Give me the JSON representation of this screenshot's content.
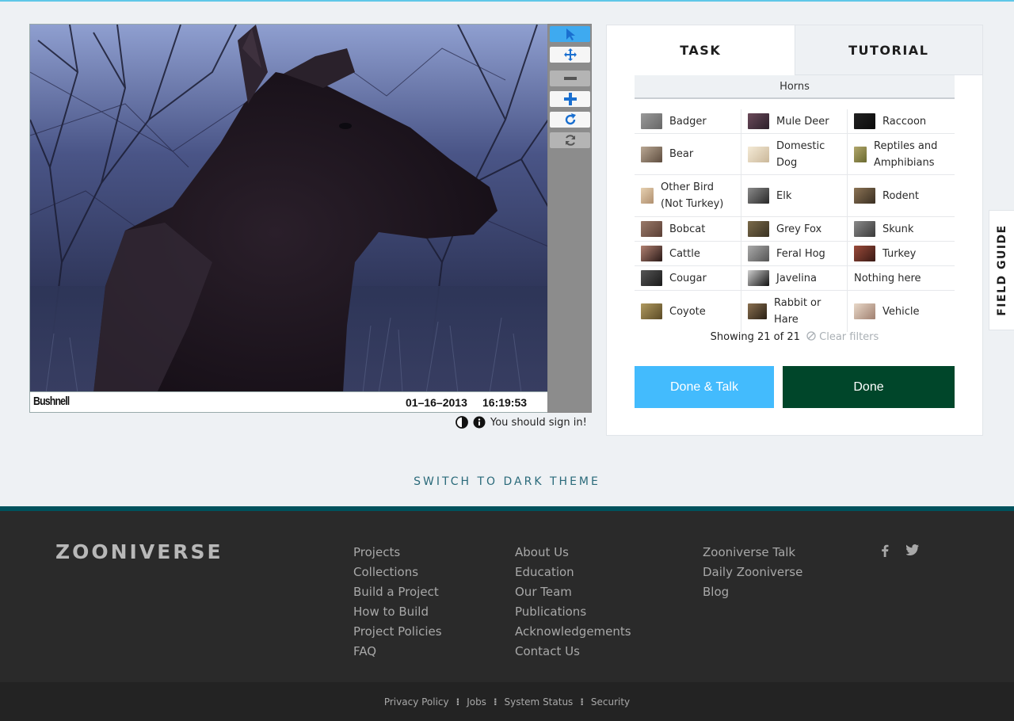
{
  "subject": {
    "camera_brand": "Bushnell",
    "date": "01–16–2013",
    "time": "16:19:53"
  },
  "toolbar": {
    "tools": [
      {
        "name": "pointer",
        "icon": "cursor-arrow-icon",
        "state": "active"
      },
      {
        "name": "pan",
        "icon": "move-arrows-icon",
        "state": "normal"
      },
      {
        "name": "zoom-out",
        "icon": "minus-icon",
        "state": "disabled"
      },
      {
        "name": "zoom-in",
        "icon": "plus-icon",
        "state": "normal"
      },
      {
        "name": "rotate",
        "icon": "rotate-icon",
        "state": "normal"
      },
      {
        "name": "reset",
        "icon": "refresh-icon",
        "state": "disabled"
      }
    ]
  },
  "viewer_meta": {
    "sign_in_text": "You should sign in!"
  },
  "task": {
    "tabs": [
      "TASK",
      "TUTORIAL"
    ],
    "filter_label": "Horns",
    "choices": [
      [
        "Badger",
        "Mule Deer",
        "Raccoon"
      ],
      [
        "Bear",
        "Domestic Dog",
        "Reptiles and Amphibians"
      ],
      [
        "Other Bird (Not Turkey)",
        "Elk",
        "Rodent"
      ],
      [
        "Bobcat",
        "Grey Fox",
        "Skunk"
      ],
      [
        "Cattle",
        "Feral Hog",
        "Turkey"
      ],
      [
        "Cougar",
        "Javelina",
        "Nothing here"
      ],
      [
        "Coyote",
        "Rabbit or Hare",
        "Vehicle"
      ]
    ],
    "showing_text": "Showing 21 of 21",
    "clear_filters": "Clear filters",
    "done_talk": "Done & Talk",
    "done": "Done"
  },
  "field_guide": "FIELD GUIDE",
  "theme_toggle": "SWITCH TO DARK THEME",
  "footer": {
    "logo": "ZOONIVERSE",
    "col1": [
      "Projects",
      "Collections",
      "Build a Project",
      "How to Build",
      "Project Policies",
      "FAQ"
    ],
    "col2": [
      "About Us",
      "Education",
      "Our Team",
      "Publications",
      "Acknowledgements",
      "Contact Us"
    ],
    "col3": [
      "Zooniverse Talk",
      "Daily Zooniverse",
      "Blog"
    ],
    "social": [
      "facebook-icon",
      "twitter-icon"
    ],
    "legal": [
      "Privacy Policy",
      "Jobs",
      "System Status",
      "Security"
    ]
  },
  "colors": {
    "accent_blue": "#43bbfd",
    "done_green": "#00462a",
    "footer_bg": "#2a2a2a",
    "footer_border": "#00525d"
  }
}
